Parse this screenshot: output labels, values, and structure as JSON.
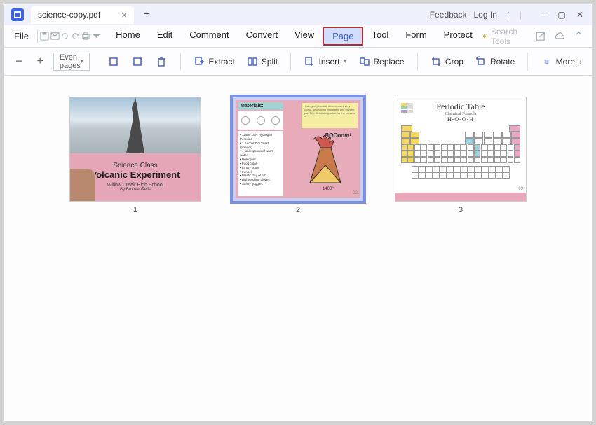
{
  "titlebar": {
    "filename": "science-copy.pdf",
    "feedback": "Feedback",
    "login": "Log In"
  },
  "menubar": {
    "file": "File",
    "items": [
      "Home",
      "Edit",
      "Comment",
      "Convert",
      "View",
      "Page",
      "Tool",
      "Form",
      "Protect"
    ],
    "highlighted_index": 5,
    "search_placeholder": "Search Tools"
  },
  "toolbar": {
    "dropdown": "Even pages",
    "extract": "Extract",
    "split": "Split",
    "insert": "Insert",
    "replace": "Replace",
    "crop": "Crop",
    "rotate": "Rotate",
    "more": "More"
  },
  "pages": {
    "selected": 2,
    "p1": {
      "num": "1",
      "t1": "Science Class",
      "t2": "Volcanic Experiment",
      "t3": "Willow Creek High School",
      "t4": "By Brooke Wells"
    },
    "p2": {
      "num": "2",
      "materials_label": "Materials:",
      "boom": "BOOoom!",
      "badge": "02",
      "list": "• 125ml 10% Hydrogen Peroxide\n• 1 Sachet Dry Yeast (powder)\n• 4 tablespoons of warm water\n• Detergent\n• Food color\n• Empty bottle\n• Funnel\n• Plastic tray or tub\n• Dishwashing gloves\n• Safety goggles",
      "postit": "Hydrogen peroxide decomposes very slowly, developing into water and oxygen gas. The division equation for the process is:"
    },
    "p3": {
      "num": "3",
      "title": "Periodic Table",
      "sub1": "Chemical Formula",
      "sub2": "H-O-O-H",
      "badge": "03"
    }
  }
}
